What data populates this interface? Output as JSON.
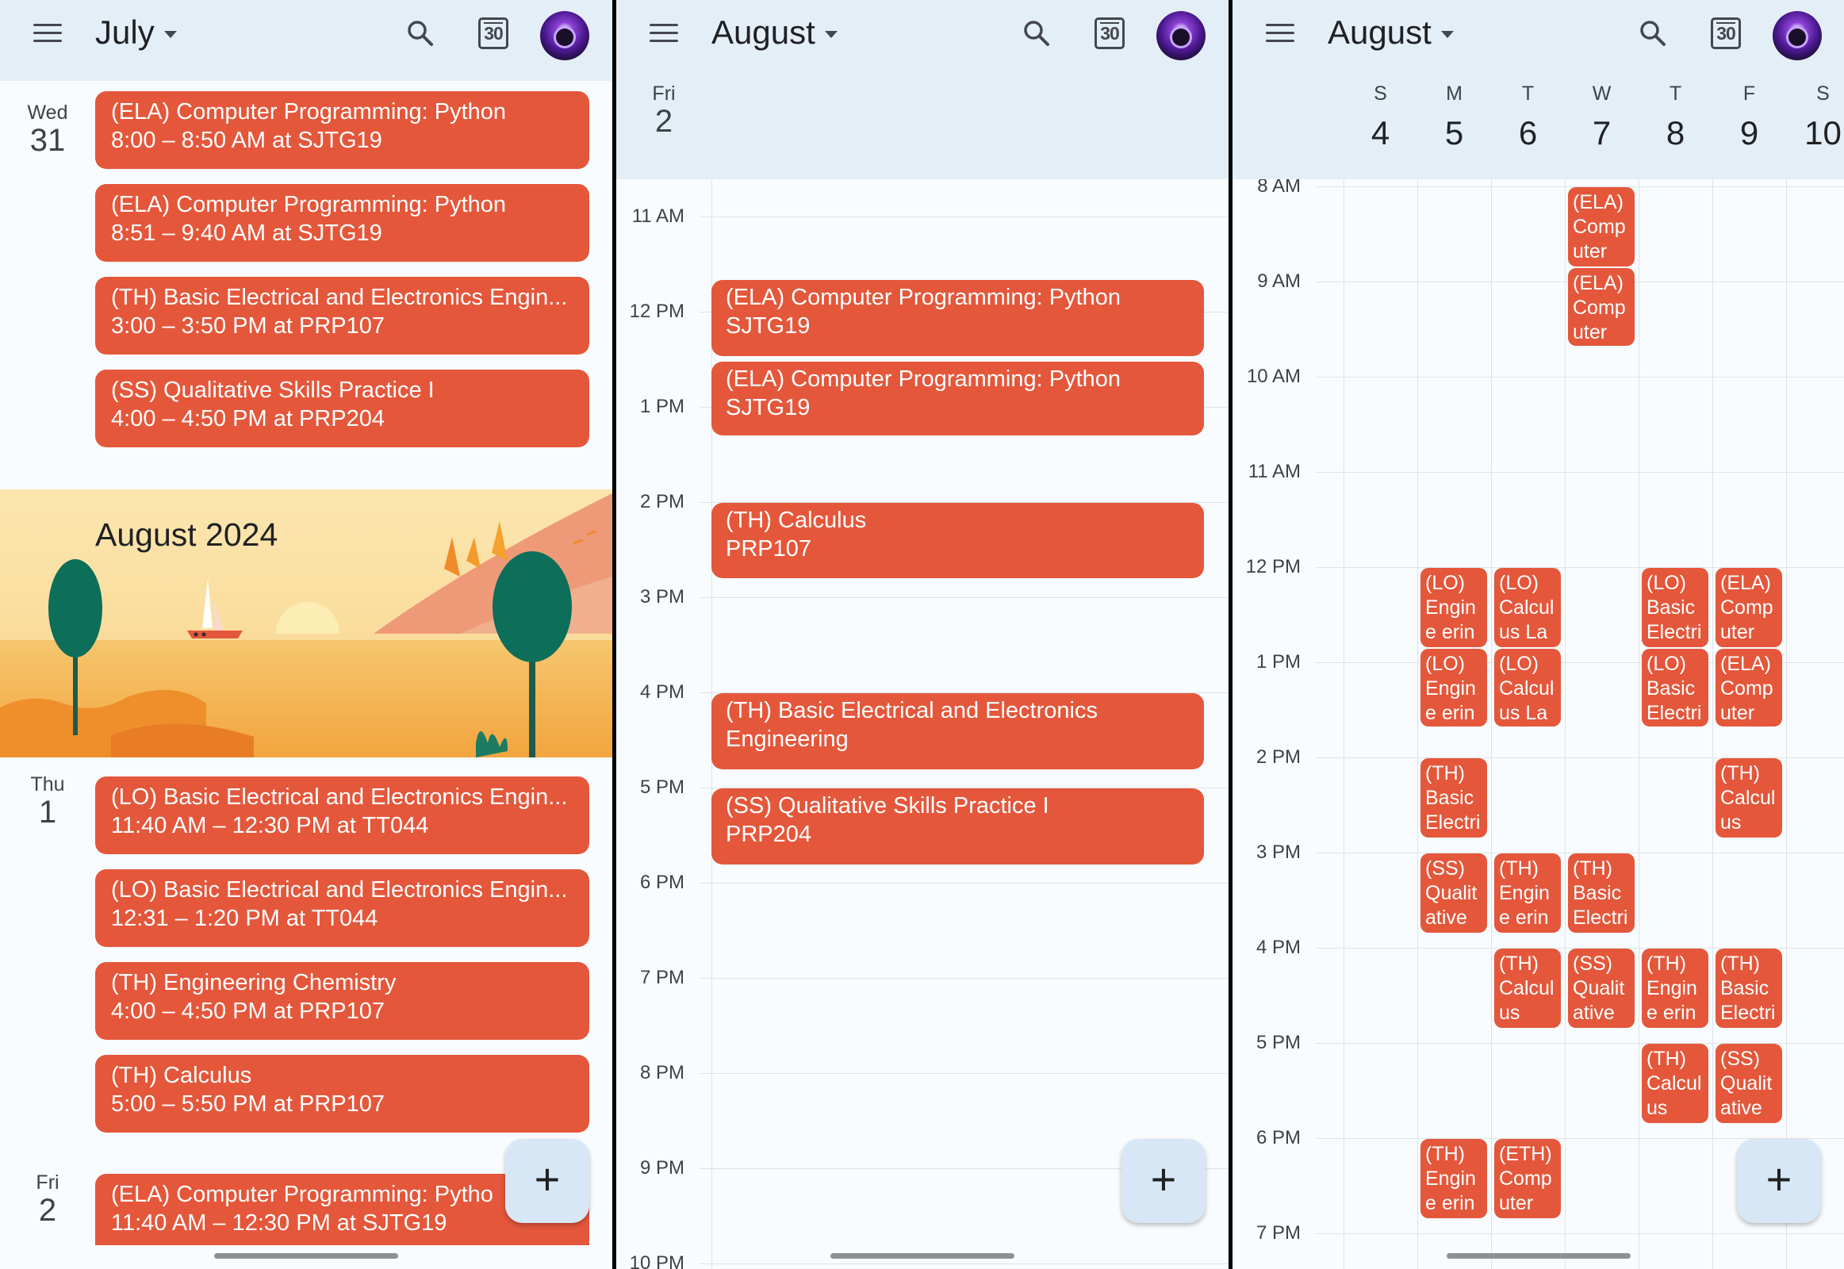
{
  "schedule": {
    "month": "July",
    "days": [
      {
        "dow": "Wed",
        "day": "31"
      },
      {
        "dow": "Thu",
        "day": "1"
      },
      {
        "dow": "Fri",
        "day": "2"
      }
    ],
    "events": [
      {
        "title": "(ELA) Computer Programming: Python",
        "detail": "8:00 – 8:50 AM at SJTG19"
      },
      {
        "title": "(ELA) Computer Programming: Python",
        "detail": "8:51 – 9:40 AM at SJTG19"
      },
      {
        "title": "(TH) Basic Electrical and Electronics Engin...",
        "detail": "3:00 – 3:50 PM at PRP107"
      },
      {
        "title": "(SS) Qualitative Skills Practice I",
        "detail": "4:00 – 4:50 PM at PRP204"
      },
      {
        "title": "(LO) Basic Electrical and Electronics Engin...",
        "detail": "11:40 AM – 12:30 PM at TT044"
      },
      {
        "title": "(LO) Basic Electrical and Electronics Engin...",
        "detail": "12:31 – 1:20 PM at TT044"
      },
      {
        "title": "(TH) Engineering Chemistry",
        "detail": "4:00 – 4:50 PM at PRP107"
      },
      {
        "title": "(TH) Calculus",
        "detail": "5:00 – 5:50 PM at PRP107"
      },
      {
        "title": "(ELA) Computer Programming: Pytho",
        "detail": "11:40 AM – 12:30 PM at SJTG19"
      }
    ],
    "banner_title": "August 2024"
  },
  "day_view": {
    "month": "August",
    "dow": "Fri",
    "day": "2",
    "hours": [
      "11 AM",
      "12 PM",
      "1 PM",
      "2 PM",
      "3 PM",
      "4 PM",
      "5 PM",
      "6 PM",
      "7 PM",
      "8 PM",
      "9 PM",
      "10 PM"
    ],
    "events": [
      {
        "title": "(ELA) Computer Programming: Python",
        "detail": "SJTG19"
      },
      {
        "title": "(ELA) Computer Programming: Python",
        "detail": "SJTG19"
      },
      {
        "title": "(TH) Calculus",
        "detail": "PRP107"
      },
      {
        "title": "(TH) Basic Electrical and Electronics Engineering",
        "detail": ""
      },
      {
        "title": "(SS) Qualitative Skills Practice I",
        "detail": "PRP204"
      }
    ]
  },
  "week_view": {
    "month": "August",
    "days": [
      {
        "dow": "S",
        "day": "4"
      },
      {
        "dow": "M",
        "day": "5"
      },
      {
        "dow": "T",
        "day": "6"
      },
      {
        "dow": "W",
        "day": "7"
      },
      {
        "dow": "T",
        "day": "8"
      },
      {
        "dow": "F",
        "day": "9"
      },
      {
        "dow": "S",
        "day": "10"
      }
    ],
    "hours": [
      "8 AM",
      "9 AM",
      "10 AM",
      "11 AM",
      "12 PM",
      "1 PM",
      "2 PM",
      "3 PM",
      "4 PM",
      "5 PM",
      "6 PM",
      "7 PM"
    ],
    "events": [
      {
        "label": "(ELA) Comp uter"
      },
      {
        "label": "(ELA) Comp uter"
      },
      {
        "label": "(LO) Engine ering"
      },
      {
        "label": "(LO) Calcul us Lab"
      },
      {
        "label": "(LO) Basic Electri"
      },
      {
        "label": "(ELA) Comp uter"
      },
      {
        "label": "(LO) Engine ering"
      },
      {
        "label": "(LO) Calcul us Lab"
      },
      {
        "label": "(LO) Basic Electri"
      },
      {
        "label": "(ELA) Comp uter"
      },
      {
        "label": "(TH) Basic Electri"
      },
      {
        "label": "(TH) Calcul us"
      },
      {
        "label": "(SS) Qualit ative"
      },
      {
        "label": "(TH) Engine ering"
      },
      {
        "label": "(TH) Basic Electri"
      },
      {
        "label": "(TH) Calcul us"
      },
      {
        "label": "(SS) Qualit ative"
      },
      {
        "label": "(TH) Engine ering"
      },
      {
        "label": "(TH) Basic Electri"
      },
      {
        "label": "(TH) Calcul us"
      },
      {
        "label": "(SS) Qualit ative"
      },
      {
        "label": "(TH) Engine ering"
      },
      {
        "label": "(ETH) Comp uter"
      }
    ]
  },
  "fab_label": "+",
  "colors": {
    "event": "#e4573b",
    "topbar": "#e4eef6",
    "fab": "#d8e7f5"
  }
}
